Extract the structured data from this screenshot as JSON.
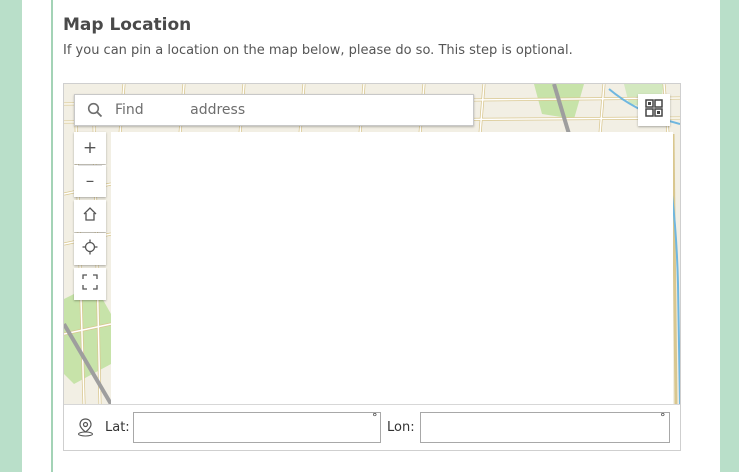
{
  "section": {
    "title": "Map Location",
    "subtitle": "If you can pin a location on the map below, please do so. This step is optional."
  },
  "map": {
    "search": {
      "placeholder": "Find address",
      "icon": "search-icon"
    },
    "controls": {
      "zoom_in": "+",
      "zoom_out": "–",
      "home_icon": "home-icon",
      "locate_icon": "locate-icon",
      "fullscreen_icon": "fullscreen-icon",
      "basemap_icon": "basemap-gallery-icon"
    },
    "colors": {
      "street": "#ffffff",
      "street_outline": "#d9c78f",
      "park": "#c7e3a9",
      "water": "#6fb7e0",
      "highway": "#9e9e9e"
    }
  },
  "coordinates": {
    "lat_label": "Lat:",
    "lon_label": "Lon:",
    "lat_value": "",
    "lon_value": "",
    "unit": "°",
    "pin_icon": "map-pin-icon"
  },
  "colors": {
    "page_background": "#b9dfc9",
    "accent_rule": "#a3d3b6"
  }
}
